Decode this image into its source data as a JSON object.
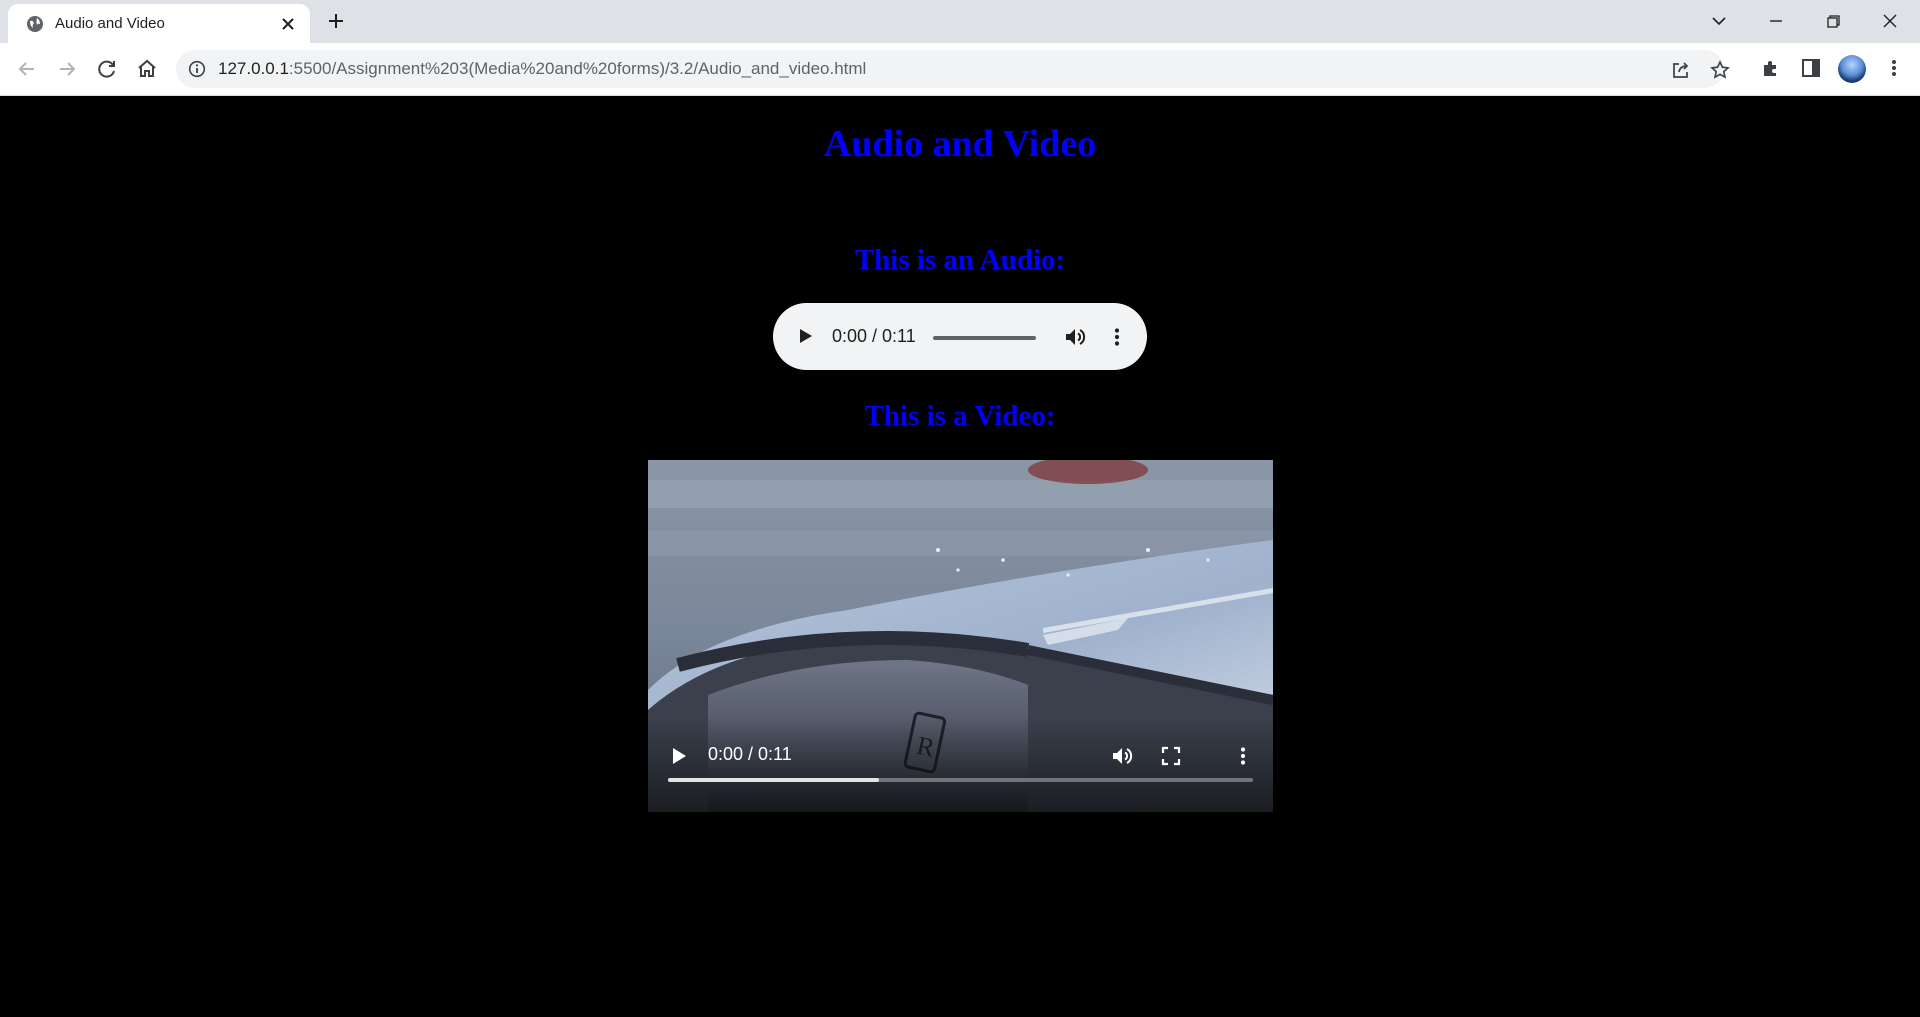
{
  "browser": {
    "tab_title": "Audio and Video",
    "url_host": "127.0.0.1",
    "url_rest": ":5500/Assignment%203(Media%20and%20forms)/3.2/Audio_and_video.html"
  },
  "page": {
    "heading": "Audio and Video",
    "audio_label": "This is an Audio:",
    "video_label": "This is a Video:"
  },
  "audio_player": {
    "time": "0:00 / 0:11",
    "progress": 0
  },
  "video_player": {
    "time": "0:00 / 0:11",
    "buffered": 0.36
  },
  "colors": {
    "heading": "#0000ff",
    "page_background": "#000000"
  },
  "icons": [
    "globe-icon",
    "close-icon",
    "plus-icon",
    "chevron-down-icon",
    "minimize-icon",
    "restore-icon",
    "window-close-icon",
    "back-icon",
    "forward-icon",
    "reload-icon",
    "home-icon",
    "info-icon",
    "share-icon",
    "star-icon",
    "extensions-icon",
    "side-panel-icon",
    "avatar",
    "more-vert-icon",
    "play-icon",
    "volume-icon",
    "fullscreen-icon"
  ]
}
